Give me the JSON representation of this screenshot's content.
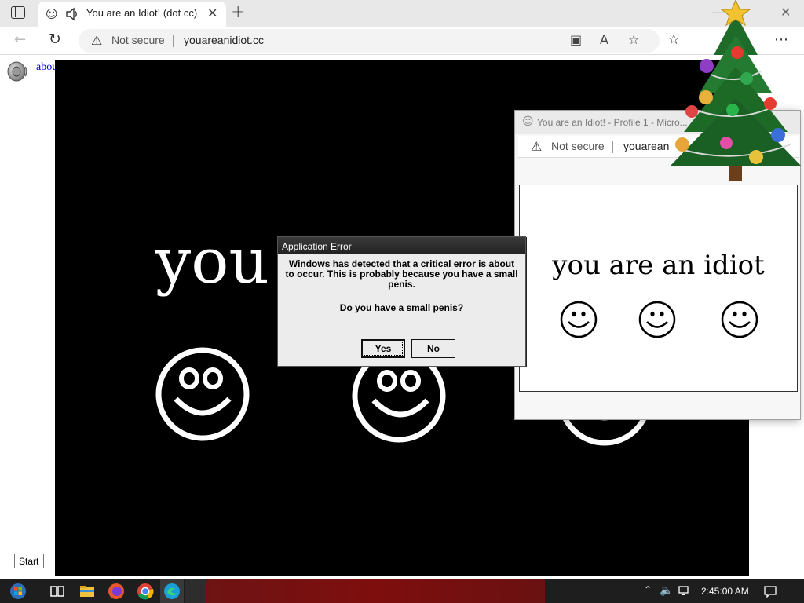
{
  "browser": {
    "tab": {
      "title": "You are an Idiot! (dot cc)"
    },
    "address": {
      "security_label": "Not secure",
      "url": "youareanidiot.cc"
    },
    "icons": [
      "tab-actions-icon",
      "smiley-favicon-icon",
      "speaker-icon",
      "close-icon",
      "plus-icon",
      "back-arrow-icon",
      "reload-icon",
      "warning-icon",
      "blocked-popup-icon",
      "read-aloud-icon",
      "add-favorite-icon",
      "favorites-icon",
      "collections-icon",
      "more-icon"
    ]
  },
  "page": {
    "link_label": "about:blank",
    "big_text": "you",
    "colors": {
      "panel": "#000000",
      "text": "#ffffff",
      "link": "#0000ee"
    }
  },
  "dialog": {
    "title": "Application Error",
    "message": "Windows has detected that a critical error is about to occur. This is probably because you have a small penis.",
    "question": "Do you have a small penis?",
    "buttons": {
      "yes": "Yes",
      "no": "No"
    }
  },
  "popup": {
    "title": "You are an Idiot! - Profile 1 - Micro...",
    "security_label": "Not secure",
    "url": "youarean",
    "text": "you are an idiot"
  },
  "taskbar": {
    "start_tooltip": "Start",
    "clock": "2:45:00 AM",
    "apps": [
      "start-icon",
      "task-view-icon",
      "file-explorer-icon",
      "firefox-icon",
      "chrome-icon",
      "edge-icon"
    ],
    "tray": [
      "chevron-up-icon",
      "volume-icon",
      "network-icon",
      "notification-icon"
    ]
  }
}
